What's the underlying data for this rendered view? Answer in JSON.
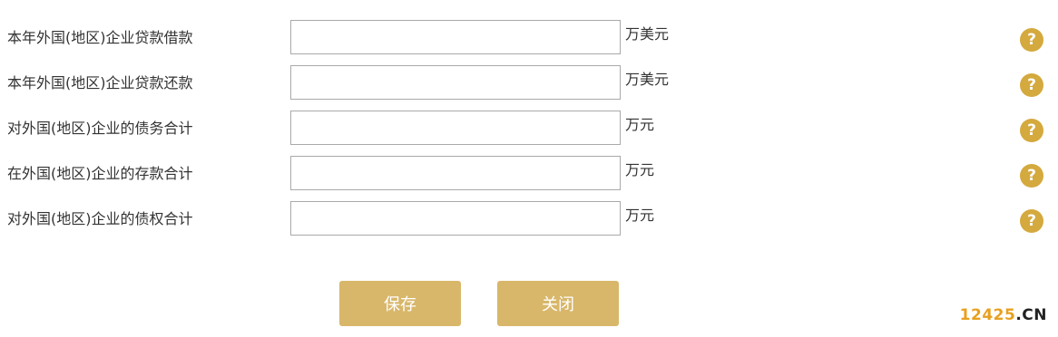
{
  "form": {
    "rows": [
      {
        "label": "本年外国(地区)企业贷款借款",
        "value": "",
        "unit": "万美元",
        "help_icon": "?"
      },
      {
        "label": "本年外国(地区)企业贷款还款",
        "value": "",
        "unit": "万美元",
        "help_icon": "?"
      },
      {
        "label": "对外国(地区)企业的债务合计",
        "value": "",
        "unit": "万元",
        "help_icon": "?"
      },
      {
        "label": "在外国(地区)企业的存款合计",
        "value": "",
        "unit": "万元",
        "help_icon": "?"
      },
      {
        "label": "对外国(地区)企业的债权合计",
        "value": "",
        "unit": "万元",
        "help_icon": "?"
      }
    ]
  },
  "actions": {
    "save_label": "保存",
    "close_label": "关闭"
  },
  "watermark": {
    "number": "12425",
    "suffix": ".CN"
  },
  "colors": {
    "button_bg": "#d8b76a",
    "help_icon_bg": "#d4a93e",
    "watermark_number": "#e8a020"
  }
}
